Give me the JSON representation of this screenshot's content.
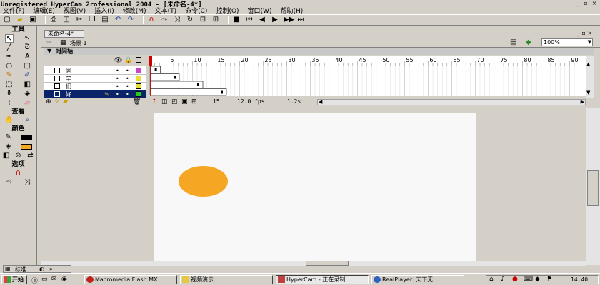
{
  "window": {
    "title": "Unregistered HyperCam 2rofessional 2004 - [未命名-4*]"
  },
  "menu": [
    "文件(F)",
    "编辑(E)",
    "视图(V)",
    "插入(I)",
    "修改(M)",
    "文本(T)",
    "命令(C)",
    "控制(O)",
    "窗口(W)",
    "帮助(H)"
  ],
  "tools": {
    "title": "工具",
    "view_title": "查看",
    "colors_title": "颜色",
    "options_title": "选项"
  },
  "document": {
    "tab": "未命名-4*",
    "scene": "场景 1",
    "zoom": "100%"
  },
  "timeline": {
    "label": "时间轴",
    "ruler": [
      "5",
      "10",
      "15",
      "20",
      "25",
      "30",
      "35",
      "40",
      "45",
      "50",
      "55",
      "60",
      "65",
      "70",
      "75",
      "80",
      "85",
      "90"
    ],
    "layers": [
      {
        "name": "同",
        "color": "#cc44cc",
        "selected": false
      },
      {
        "name": "学",
        "color": "#e8e030",
        "selected": false
      },
      {
        "name": "们",
        "color": "#e8e030",
        "selected": false
      },
      {
        "name": "好",
        "color": "#22cc22",
        "selected": true
      }
    ],
    "current_frame": "15",
    "fps": "12.0 fps",
    "time": "1.2s"
  },
  "stage": {
    "shape_color": "#f5a623"
  },
  "options_bar": {
    "label": "标准"
  },
  "taskbar": {
    "start": "开始",
    "items": [
      "Macromedia Flash MX...",
      "视频演示",
      "HyperCam - 正在录制",
      "RealPlayer: 天下无..."
    ],
    "clock": "14:40"
  }
}
